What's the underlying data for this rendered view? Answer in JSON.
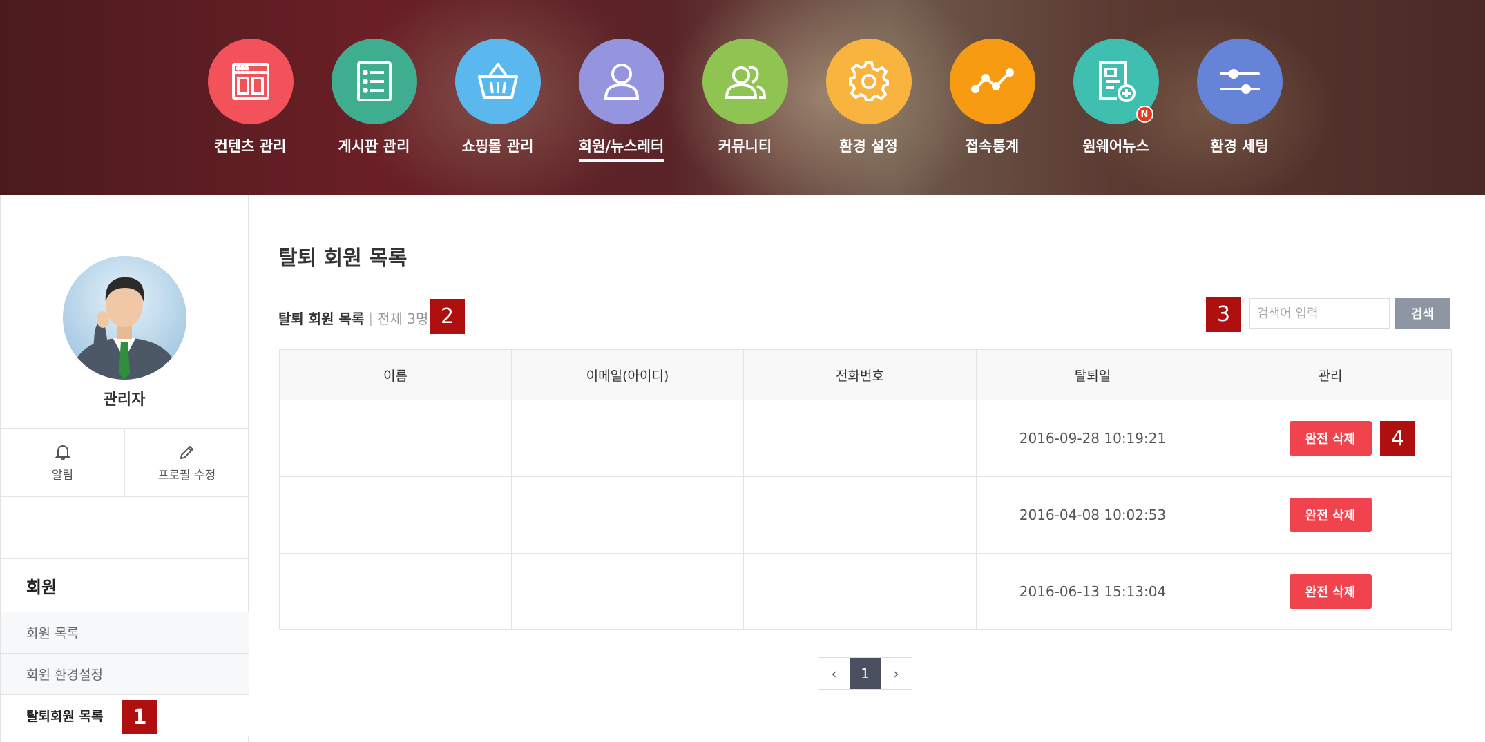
{
  "nav": {
    "items": [
      {
        "label": "컨텐츠 관리",
        "icon": "layout-icon",
        "color": "#f4525a"
      },
      {
        "label": "게시판 관리",
        "icon": "list-icon",
        "color": "#3fad8f"
      },
      {
        "label": "쇼핑몰 관리",
        "icon": "basket-icon",
        "color": "#5ab8ef"
      },
      {
        "label": "회원/뉴스레터",
        "icon": "user-icon",
        "color": "#9494df"
      },
      {
        "label": "커뮤니티",
        "icon": "users-icon",
        "color": "#8fc452"
      },
      {
        "label": "환경 설정",
        "icon": "gear-icon",
        "color": "#f8b43f"
      },
      {
        "label": "접속통계",
        "icon": "trend-icon",
        "color": "#f79b12"
      },
      {
        "label": "원웨어뉴스",
        "icon": "document-add-icon",
        "color": "#3fbfb0"
      },
      {
        "label": "환경 세팅",
        "icon": "sliders-icon",
        "color": "#6584d8"
      }
    ],
    "new_badge": "N"
  },
  "profile": {
    "name": "관리자",
    "actions": [
      {
        "label": "알림",
        "icon": "bell-icon"
      },
      {
        "label": "프로필 수정",
        "icon": "pencil-icon"
      }
    ]
  },
  "side_menu": {
    "title": "회원",
    "items": [
      {
        "label": "회원 목록"
      },
      {
        "label": "회원 환경설정"
      },
      {
        "label": "탈퇴회원 목록"
      }
    ]
  },
  "markers": [
    "1",
    "2",
    "3",
    "4"
  ],
  "main": {
    "title": "탈퇴 회원 목록",
    "list_label": "탈퇴 회원 목록",
    "list_sep": "|",
    "list_count": "전체 3명",
    "search": {
      "placeholder": "검색어 입력",
      "button": "검색"
    },
    "table": {
      "columns": [
        "이름",
        "이메일(아이디)",
        "전화번호",
        "탈퇴일",
        "관리"
      ],
      "rows": [
        {
          "name": "",
          "email": "",
          "phone": "",
          "date": "2016-09-28 10:19:21",
          "action": "완전 삭제"
        },
        {
          "name": "",
          "email": "",
          "phone": "",
          "date": "2016-04-08 10:02:53",
          "action": "완전 삭제"
        },
        {
          "name": "",
          "email": "",
          "phone": "",
          "date": "2016-06-13 15:13:04",
          "action": "완전 삭제"
        }
      ]
    },
    "pagination": {
      "prev": "‹",
      "current": "1",
      "next": "›"
    }
  }
}
